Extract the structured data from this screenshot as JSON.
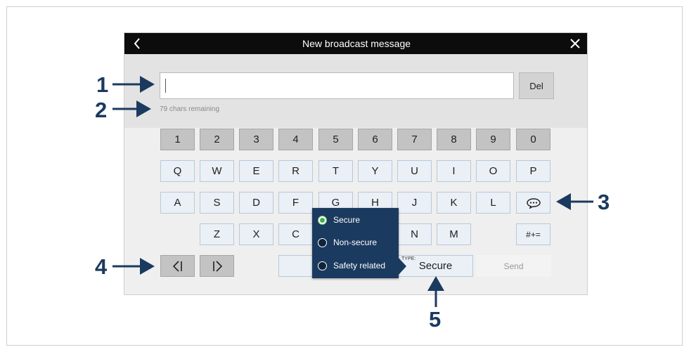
{
  "dialog": {
    "title": "New broadcast message",
    "back_icon": "chevron-left-icon",
    "close_icon": "close-x-icon"
  },
  "message": {
    "value": "",
    "delete_label": "Del",
    "chars_remaining": "79 chars remaining"
  },
  "keyboard": {
    "row1": [
      "1",
      "2",
      "3",
      "4",
      "5",
      "6",
      "7",
      "8",
      "9",
      "0"
    ],
    "row2": [
      "Q",
      "W",
      "E",
      "R",
      "T",
      "Y",
      "U",
      "I",
      "O",
      "P"
    ],
    "row3": [
      "A",
      "S",
      "D",
      "F",
      "G",
      "H",
      "J",
      "K",
      "L"
    ],
    "row4": [
      "Z",
      "X",
      "C",
      "N",
      "M"
    ],
    "symbols_label": "#+=",
    "message_templates_icon": "speech-bubble-icon",
    "cursor_left_icon": "cursor-left-icon",
    "cursor_right_icon": "cursor-right-icon",
    "type_caption": "TYPE:",
    "type_value": "Secure",
    "send_label": "Send"
  },
  "type_menu": {
    "options": [
      {
        "label": "Secure",
        "selected": true
      },
      {
        "label": "Non-secure",
        "selected": false
      },
      {
        "label": "Safety related",
        "selected": false
      }
    ]
  },
  "callouts": [
    "1",
    "2",
    "3",
    "4",
    "5"
  ],
  "colors": {
    "callout": "#1b3a5f",
    "titlebar": "#0c0c0c",
    "popup": "#1b3a5f",
    "selected_radio": "#3db34a"
  }
}
